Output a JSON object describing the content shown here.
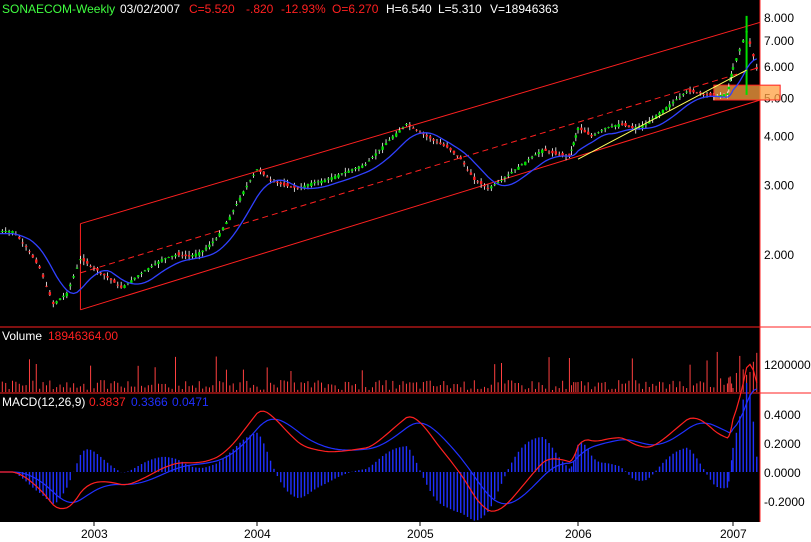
{
  "header": {
    "symbol": "SONAECOM-Weekly",
    "date": "03/02/2007",
    "close": "C=5.520",
    "change": "-.820",
    "change_pct": "-12.93%",
    "open": "O=6.270",
    "high": "H=6.540",
    "low": "L=5.310",
    "volume": "V=18946363"
  },
  "colors": {
    "background": "#000000",
    "axis_panel": "#ffffff",
    "up_bar": "#00e000",
    "down_bar": "#ff2020",
    "channel": "#ff2020",
    "trendline": "#ffff60",
    "highlight": "#ffa040",
    "volume_bar": "#ff4040",
    "macd_line": "#ff2020",
    "signal_line": "#2030ff",
    "histogram": "#2030ff",
    "header_text": "#ffffff",
    "symbol_text": "#40ff40"
  },
  "volume_panel": {
    "label": "Volume",
    "value": "18946364.00",
    "tick": "1200000"
  },
  "macd_panel": {
    "label": "MACD(12,26,9)",
    "macd": "0.3837",
    "signal": "0.3366",
    "histogram": "0.0471",
    "ticks": [
      "0.4000",
      "0.2000",
      "0.0000",
      "-0.2000"
    ]
  },
  "chart_data": {
    "type": "candlestick",
    "y_scale": "log",
    "price_ticks": [
      "8.000",
      "7.000",
      "6.000",
      "5.000",
      "4.000",
      "3.000",
      "2.000"
    ],
    "x_tick_labels": [
      "2003",
      "2004",
      "2005",
      "2006",
      "2007"
    ],
    "price_path": [
      [
        "2002-06",
        2.3
      ],
      [
        "2002-07",
        2.3
      ],
      [
        "2002-08",
        2.1
      ],
      [
        "2002-09",
        1.85
      ],
      [
        "2002-10",
        1.5
      ],
      [
        "2002-11",
        1.6
      ],
      [
        "2002-12",
        1.95
      ],
      [
        "2003-01",
        1.85
      ],
      [
        "2003-02",
        1.75
      ],
      [
        "2003-03",
        1.65
      ],
      [
        "2003-04",
        1.75
      ],
      [
        "2003-05",
        1.85
      ],
      [
        "2003-06",
        1.95
      ],
      [
        "2003-07",
        2.0
      ],
      [
        "2003-08",
        1.98
      ],
      [
        "2003-09",
        2.05
      ],
      [
        "2003-10",
        2.2
      ],
      [
        "2003-11",
        2.5
      ],
      [
        "2003-12",
        2.9
      ],
      [
        "2004-01",
        3.3
      ],
      [
        "2004-02",
        3.1
      ],
      [
        "2004-03",
        3.0
      ],
      [
        "2004-04",
        2.95
      ],
      [
        "2004-05",
        3.05
      ],
      [
        "2004-06",
        3.1
      ],
      [
        "2004-07",
        3.2
      ],
      [
        "2004-08",
        3.3
      ],
      [
        "2004-09",
        3.4
      ],
      [
        "2004-10",
        3.7
      ],
      [
        "2004-11",
        4.0
      ],
      [
        "2004-12",
        4.3
      ],
      [
        "2005-01",
        4.1
      ],
      [
        "2005-02",
        3.9
      ],
      [
        "2005-03",
        3.75
      ],
      [
        "2005-04",
        3.5
      ],
      [
        "2005-05",
        3.1
      ],
      [
        "2005-06",
        2.95
      ],
      [
        "2005-07",
        3.1
      ],
      [
        "2005-08",
        3.3
      ],
      [
        "2005-09",
        3.5
      ],
      [
        "2005-10",
        3.7
      ],
      [
        "2005-11",
        3.6
      ],
      [
        "2005-12",
        3.55
      ],
      [
        "2006-01",
        4.2
      ],
      [
        "2006-02",
        4.0
      ],
      [
        "2006-03",
        4.2
      ],
      [
        "2006-04",
        4.3
      ],
      [
        "2006-05",
        4.2
      ],
      [
        "2006-06",
        4.3
      ],
      [
        "2006-07",
        4.6
      ],
      [
        "2006-08",
        4.9
      ],
      [
        "2006-09",
        5.2
      ],
      [
        "2006-10",
        5.15
      ],
      [
        "2006-11",
        5.05
      ],
      [
        "2006-12",
        5.15
      ],
      [
        "2007-01",
        6.0
      ],
      [
        "2007-02",
        7.4
      ],
      [
        "2007-03",
        5.52
      ]
    ],
    "channel": {
      "upper": [
        [
          "2002-12",
          2.4
        ],
        [
          "2007-03",
          7.8
        ]
      ],
      "middle": [
        [
          "2002-12",
          1.8
        ],
        [
          "2007-03",
          6.0
        ]
      ],
      "lower": [
        [
          "2002-12",
          1.45
        ],
        [
          "2007-03",
          4.95
        ]
      ]
    },
    "support_trend": [
      [
        "2006-01",
        3.5
      ],
      [
        "2007-02",
        5.9
      ]
    ]
  }
}
